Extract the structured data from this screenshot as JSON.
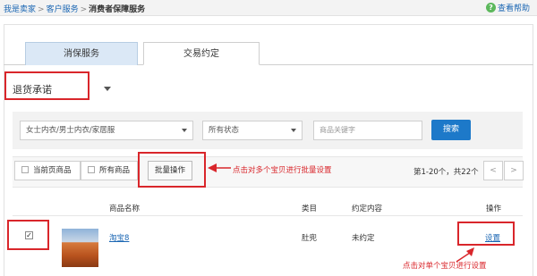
{
  "breadcrumb": {
    "items": [
      "我是卖家",
      "客户服务",
      "消费者保障服务"
    ],
    "separator": ">"
  },
  "help": {
    "label": "查看帮助",
    "icon": "question-circle-icon"
  },
  "tabs": [
    {
      "label": "消保服务",
      "active": false
    },
    {
      "label": "交易约定",
      "active": true
    }
  ],
  "promise_select": {
    "value": "退货承诺",
    "icon": "caret-down-icon"
  },
  "filters": {
    "category": "女士内衣/男士内衣/家居服",
    "status": "所有状态",
    "keyword_placeholder": "商品关键字",
    "search_label": "搜索"
  },
  "toolbar": {
    "current_page_items": "当前页商品",
    "all_items": "所有商品",
    "batch_label": "批量操作",
    "pagination_text": "第1-20个，共22个",
    "prev": "<",
    "next": ">"
  },
  "table": {
    "headers": {
      "name": "商品名称",
      "category": "类目",
      "content": "约定内容",
      "operation": "操作"
    },
    "rows": [
      {
        "checked": true,
        "name": "淘宝8",
        "category": "肚兜",
        "content": "未约定",
        "operation": "设置"
      }
    ]
  },
  "annotations": {
    "batch_hint": "点击对多个宝贝进行批量设置",
    "single_hint": "点击对单个宝贝进行设置"
  },
  "colors": {
    "accent_blue": "#1d79c9",
    "link_blue": "#1a66b3",
    "annotation_red": "#d9262b",
    "help_green": "#5cb85c"
  }
}
